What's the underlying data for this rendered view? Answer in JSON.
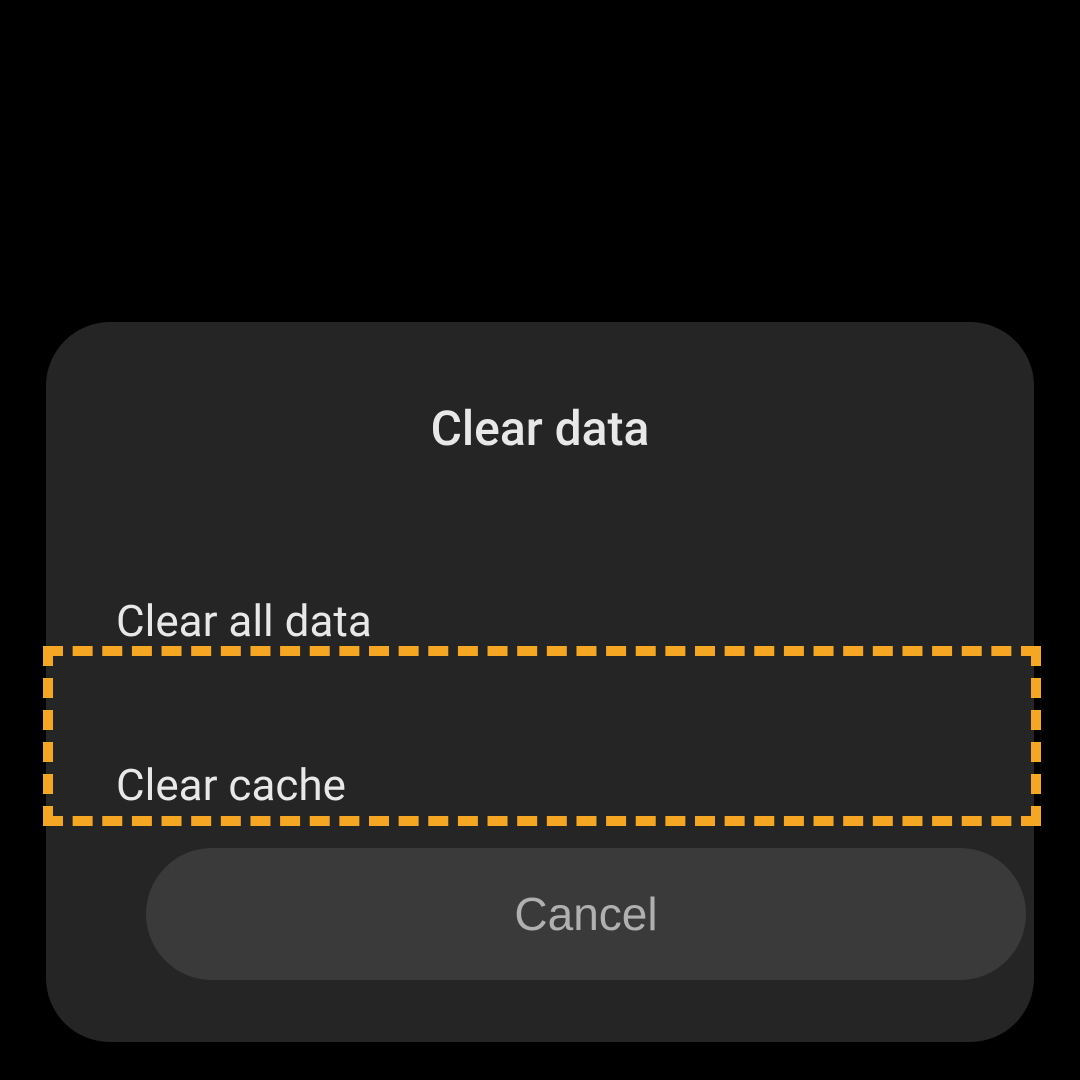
{
  "dialog": {
    "title": "Clear data",
    "options": [
      {
        "label": "Clear all data"
      },
      {
        "label": "Clear cache"
      }
    ],
    "cancel_label": "Cancel"
  }
}
